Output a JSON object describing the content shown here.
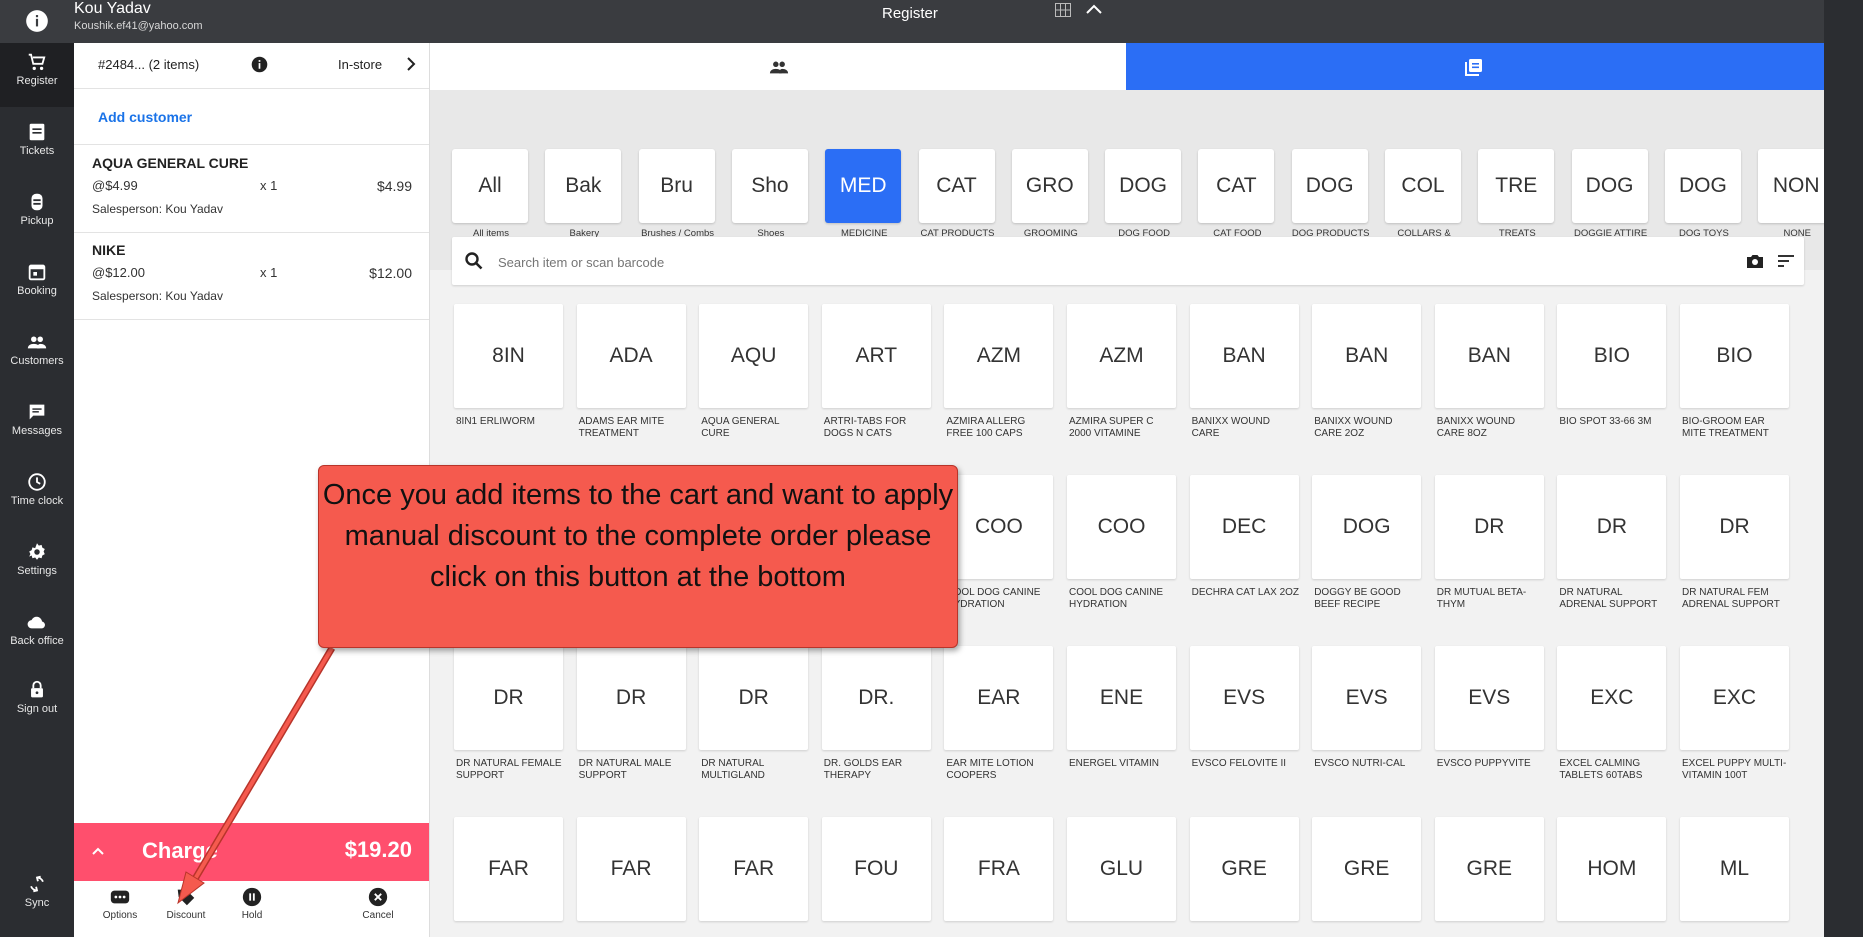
{
  "header": {
    "user_name": "Kou Yadav",
    "user_email": "Koushik.ef41@yahoo.com",
    "title": "Register"
  },
  "nav": [
    {
      "label": "Register",
      "icon": "cart-icon"
    },
    {
      "label": "Tickets",
      "icon": "ticket-icon"
    },
    {
      "label": "Pickup",
      "icon": "pickup-icon"
    },
    {
      "label": "Booking",
      "icon": "calendar-icon"
    },
    {
      "label": "Customers",
      "icon": "people-icon"
    },
    {
      "label": "Messages",
      "icon": "message-icon"
    },
    {
      "label": "Time clock",
      "icon": "clock-icon"
    },
    {
      "label": "Settings",
      "icon": "gear-icon"
    },
    {
      "label": "Back office",
      "icon": "cloud-icon"
    },
    {
      "label": "Sign out",
      "icon": "lock-icon"
    },
    {
      "label": "Sync",
      "icon": "sync-icon"
    }
  ],
  "cart": {
    "order_id": "#2484... (2 items)",
    "order_type": "In-store",
    "add_customer": "Add customer",
    "items": [
      {
        "name": "AQUA GENERAL CURE",
        "price": "@$4.99",
        "qty": "x 1",
        "total": "$4.99",
        "salesperson": "Salesperson: Kou Yadav"
      },
      {
        "name": "NIKE",
        "price": "@$12.00",
        "qty": "x 1",
        "total": "$12.00",
        "salesperson": "Salesperson: Kou Yadav"
      }
    ],
    "charge_label": "Charge",
    "charge_total": "$19.20",
    "actions": {
      "options": "Options",
      "discount": "Discount",
      "hold": "Hold",
      "cancel": "Cancel"
    }
  },
  "categories": [
    {
      "abbr": "All",
      "label": "All items"
    },
    {
      "abbr": "Bak",
      "label": "Bakery"
    },
    {
      "abbr": "Bru",
      "label": "Brushes / Combs"
    },
    {
      "abbr": "Sho",
      "label": "Shoes"
    },
    {
      "abbr": "MED",
      "label": "MEDICINE PRODUCTS",
      "active": true
    },
    {
      "abbr": "CAT",
      "label": "CAT PRODUCTS"
    },
    {
      "abbr": "GRO",
      "label": "GROOMING PRODUCTS"
    },
    {
      "abbr": "DOG",
      "label": "DOG FOOD"
    },
    {
      "abbr": "CAT",
      "label": "CAT FOOD"
    },
    {
      "abbr": "DOG",
      "label": "DOG PRODUCTS"
    },
    {
      "abbr": "COL",
      "label": "COLLARS & LEASHES"
    },
    {
      "abbr": "TRE",
      "label": "TREATS"
    },
    {
      "abbr": "DOG",
      "label": "DOGGIE ATTIRE"
    },
    {
      "abbr": "DOG",
      "label": "DOG TOYS"
    },
    {
      "abbr": "NON",
      "label": "NONE"
    }
  ],
  "search": {
    "placeholder": "Search item or scan barcode"
  },
  "tiles": [
    [
      {
        "abbr": "8IN",
        "label": "8IN1 ERLIWORM"
      },
      {
        "abbr": "ADA",
        "label": "ADAMS EAR MITE TREATMENT"
      },
      {
        "abbr": "AQU",
        "label": "AQUA GENERAL CURE"
      },
      {
        "abbr": "ART",
        "label": "ARTRI-TABS FOR DOGS N CATS"
      },
      {
        "abbr": "AZM",
        "label": "AZMIRA ALLERG FREE 100 CAPS"
      },
      {
        "abbr": "AZM",
        "label": "AZMIRA SUPER C 2000 VITAMINE"
      },
      {
        "abbr": "BAN",
        "label": "BANIXX WOUND CARE"
      },
      {
        "abbr": "BAN",
        "label": "BANIXX WOUND CARE 2OZ"
      },
      {
        "abbr": "BAN",
        "label": "BANIXX WOUND CARE 8OZ"
      },
      {
        "abbr": "BIO",
        "label": "BIO SPOT 33-66 3M"
      },
      {
        "abbr": "BIO",
        "label": "BIO-GROOM EAR MITE TREATMENT"
      }
    ],
    [
      {
        "abbr": "",
        "label": ""
      },
      {
        "abbr": "",
        "label": ""
      },
      {
        "abbr": "",
        "label": ""
      },
      {
        "abbr": "",
        "label": ""
      },
      {
        "abbr": "COO",
        "label": "COOL DOG CANINE HYDRATION"
      },
      {
        "abbr": "COO",
        "label": "COOL DOG CANINE HYDRATION"
      },
      {
        "abbr": "DEC",
        "label": "DECHRA CAT LAX 2OZ"
      },
      {
        "abbr": "DOG",
        "label": "DOGGY BE GOOD BEEF RECIPE"
      },
      {
        "abbr": "DR",
        "label": "DR MUTUAL BETA-THYM"
      },
      {
        "abbr": "DR",
        "label": "DR NATURAL ADRENAL SUPPORT"
      },
      {
        "abbr": "DR",
        "label": "DR NATURAL FEM ADRENAL SUPPORT"
      }
    ],
    [
      {
        "abbr": "DR",
        "label": "DR NATURAL FEMALE SUPPORT"
      },
      {
        "abbr": "DR",
        "label": "DR NATURAL MALE SUPPORT"
      },
      {
        "abbr": "DR",
        "label": "DR NATURAL MULTIGLAND"
      },
      {
        "abbr": "DR.",
        "label": "DR. GOLDS EAR THERAPY"
      },
      {
        "abbr": "EAR",
        "label": "EAR MITE LOTION COOPERS"
      },
      {
        "abbr": "ENE",
        "label": "ENERGEL VITAMIN"
      },
      {
        "abbr": "EVS",
        "label": "EVSCO FELOVITE II"
      },
      {
        "abbr": "EVS",
        "label": "EVSCO NUTRI-CAL"
      },
      {
        "abbr": "EVS",
        "label": "EVSCO PUPPYVITE"
      },
      {
        "abbr": "EXC",
        "label": "EXCEL CALMING TABLETS 60TABS"
      },
      {
        "abbr": "EXC",
        "label": "EXCEL PUPPY MULTI-VITAMIN 100T"
      }
    ],
    [
      {
        "abbr": "FAR",
        "label": ""
      },
      {
        "abbr": "FAR",
        "label": ""
      },
      {
        "abbr": "FAR",
        "label": ""
      },
      {
        "abbr": "FOU",
        "label": ""
      },
      {
        "abbr": "FRA",
        "label": ""
      },
      {
        "abbr": "GLU",
        "label": ""
      },
      {
        "abbr": "GRE",
        "label": ""
      },
      {
        "abbr": "GRE",
        "label": ""
      },
      {
        "abbr": "GRE",
        "label": ""
      },
      {
        "abbr": "HOM",
        "label": ""
      },
      {
        "abbr": "ML",
        "label": ""
      }
    ]
  ],
  "callout": {
    "text": "Once you add items to the cart and want to apply manual discount to the complete order please click on this button at the bottom"
  }
}
